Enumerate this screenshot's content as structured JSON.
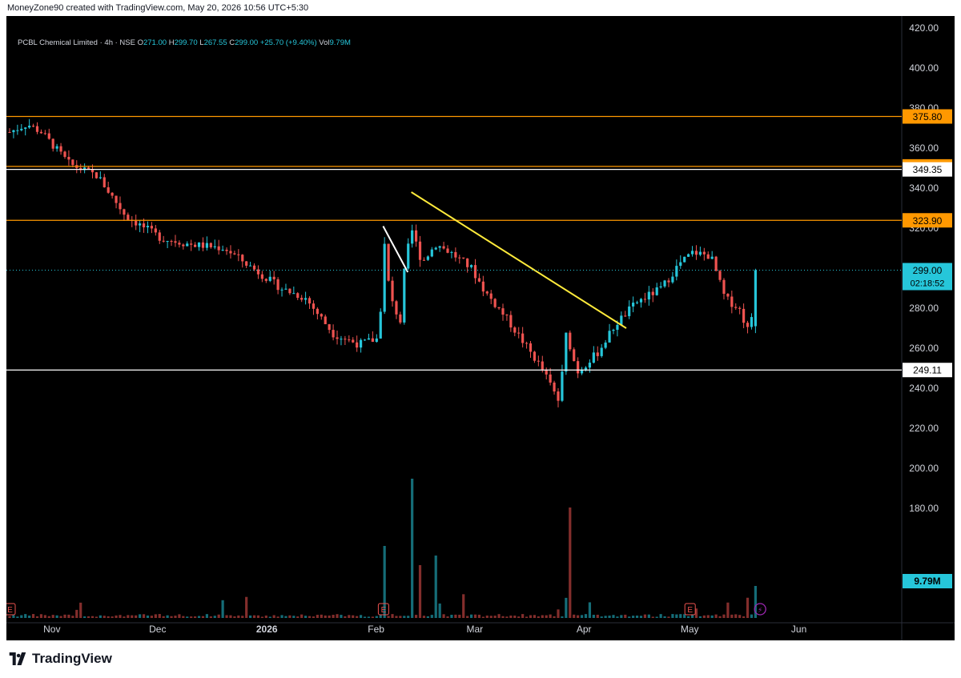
{
  "header": {
    "created_by": "MoneyZone90 created with TradingView.com, May 20, 2026 10:56 UTC+5:30"
  },
  "legend": {
    "symbol": "PCBL Chemical Limited · 4h · NSE",
    "open_label": "O",
    "open": "271.00",
    "high_label": "H",
    "high": "299.70",
    "low_label": "L",
    "low": "267.55",
    "close_label": "C",
    "close": "299.00",
    "change": "+25.70 (+9.40%)",
    "vol_label": "Vol",
    "vol": "9.79M"
  },
  "brand": {
    "name": "TradingView"
  },
  "colors": {
    "background": "#000000",
    "up": "#26c6da",
    "down": "#ef5350",
    "orange_level": "#ff9800",
    "white_level": "#ffffff",
    "trendline": "#ffeb3b",
    "earnings": "#ef5350",
    "dividend": "#9c27b0"
  },
  "chart_data": {
    "type": "candlestick",
    "timeframe": "4h",
    "x_labels": [
      "Nov",
      "Dec",
      "2026",
      "Feb",
      "Mar",
      "Apr",
      "May",
      "Jun"
    ],
    "y_ticks": [
      "420.00",
      "400.00",
      "380.00",
      "360.00",
      "340.00",
      "320.00",
      "280.00",
      "260.00",
      "240.00",
      "220.00",
      "200.00",
      "180.00"
    ],
    "ylim": [
      176,
      424
    ],
    "grid": false,
    "horizontal_levels": [
      {
        "value": 375.8,
        "label": "375.80",
        "color": "orange"
      },
      {
        "value": 350.85,
        "label": "350.85",
        "color": "orange"
      },
      {
        "value": 349.35,
        "label": "349.35",
        "color": "white"
      },
      {
        "value": 323.9,
        "label": "323.90",
        "color": "orange"
      },
      {
        "value": 249.11,
        "label": "249.11",
        "color": "white"
      }
    ],
    "current_price": {
      "value": 299.0,
      "label": "299.00",
      "countdown": "02:18:52"
    },
    "volume_label": "9.79M",
    "trendlines": [
      {
        "color": "yellow",
        "from": {
          "date": "2026-02-11",
          "price": 338
        },
        "to": {
          "date": "2026-04-13",
          "price": 270
        }
      },
      {
        "color": "white",
        "from": {
          "date": "2026-02-03",
          "price": 321
        },
        "to": {
          "date": "2026-02-10",
          "price": 298
        }
      }
    ],
    "events": [
      {
        "type": "earnings",
        "date": "2025-10-20",
        "label": "E"
      },
      {
        "type": "earnings",
        "date": "2026-02-03",
        "label": "E"
      },
      {
        "type": "earnings",
        "date": "2026-05-01",
        "label": "E"
      },
      {
        "type": "dividend",
        "date": "2026-05-21",
        "label": "⚡"
      }
    ],
    "price_path": [
      {
        "date": "2025-10-20",
        "price": 368
      },
      {
        "date": "2025-10-25",
        "price": 372
      },
      {
        "date": "2025-10-29",
        "price": 368
      },
      {
        "date": "2025-11-06",
        "price": 352
      },
      {
        "date": "2025-11-14",
        "price": 346
      },
      {
        "date": "2025-11-22",
        "price": 326
      },
      {
        "date": "2025-12-02",
        "price": 315
      },
      {
        "date": "2025-12-10",
        "price": 312
      },
      {
        "date": "2025-12-20",
        "price": 310
      },
      {
        "date": "2025-12-28",
        "price": 300
      },
      {
        "date": "2026-01-05",
        "price": 290
      },
      {
        "date": "2026-01-12",
        "price": 285
      },
      {
        "date": "2026-01-20",
        "price": 267
      },
      {
        "date": "2026-01-27",
        "price": 262
      },
      {
        "date": "2026-02-02",
        "price": 265
      },
      {
        "date": "2026-02-03",
        "price": 318
      },
      {
        "date": "2026-02-05",
        "price": 285
      },
      {
        "date": "2026-02-08",
        "price": 273
      },
      {
        "date": "2026-02-09",
        "price": 298
      },
      {
        "date": "2026-02-11",
        "price": 320
      },
      {
        "date": "2026-02-14",
        "price": 303
      },
      {
        "date": "2026-02-18",
        "price": 312
      },
      {
        "date": "2026-02-22",
        "price": 308
      },
      {
        "date": "2026-02-28",
        "price": 300
      },
      {
        "date": "2026-03-04",
        "price": 288
      },
      {
        "date": "2026-03-10",
        "price": 275
      },
      {
        "date": "2026-03-16",
        "price": 260
      },
      {
        "date": "2026-03-20",
        "price": 250
      },
      {
        "date": "2026-03-25",
        "price": 233
      },
      {
        "date": "2026-03-27",
        "price": 268
      },
      {
        "date": "2026-03-30",
        "price": 248
      },
      {
        "date": "2026-04-05",
        "price": 258
      },
      {
        "date": "2026-04-10",
        "price": 272
      },
      {
        "date": "2026-04-16",
        "price": 283
      },
      {
        "date": "2026-04-23",
        "price": 290
      },
      {
        "date": "2026-04-28",
        "price": 302
      },
      {
        "date": "2026-05-02",
        "price": 308
      },
      {
        "date": "2026-05-07",
        "price": 306
      },
      {
        "date": "2026-05-11",
        "price": 285
      },
      {
        "date": "2026-05-15",
        "price": 280
      },
      {
        "date": "2026-05-18",
        "price": 267
      },
      {
        "date": "2026-05-20",
        "price": 299
      }
    ]
  }
}
